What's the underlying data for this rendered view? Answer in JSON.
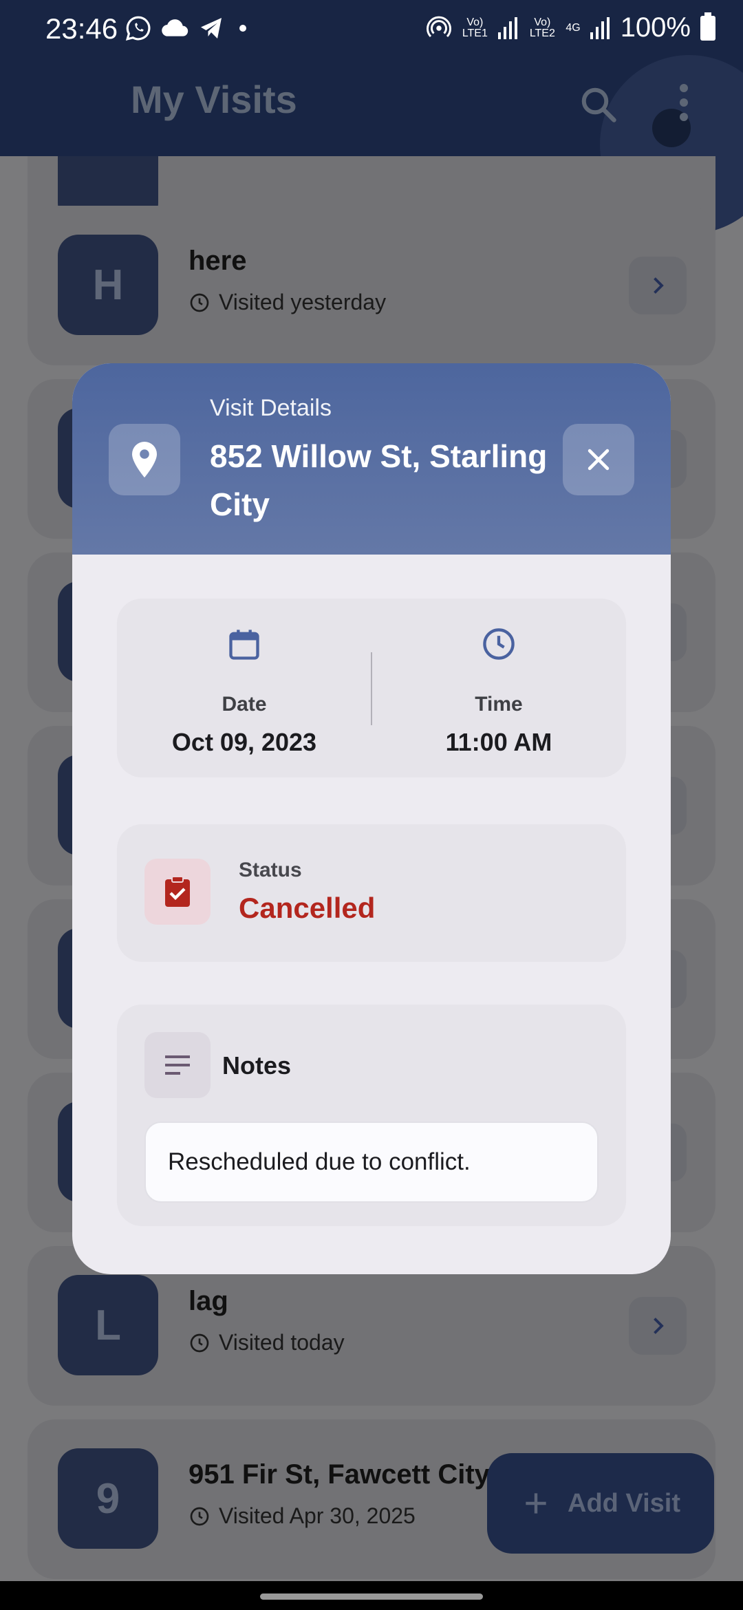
{
  "status_bar": {
    "time": "23:46",
    "network_1": "Vo) LTE1",
    "network_2": "Vo) LTE2",
    "network_type": "4G",
    "battery": "100%"
  },
  "app_bar": {
    "title": "My Visits",
    "search_icon": "search-icon",
    "menu_icon": "more-vert-icon"
  },
  "visits": [
    {
      "initial": "H",
      "name": "here",
      "visited": "Visited yesterday"
    },
    {
      "initial": "L",
      "name": "lag",
      "visited": "Visited today"
    },
    {
      "initial": "9",
      "name": "951 Fir St, Fawcett City",
      "visited": "Visited Apr 30, 2025"
    }
  ],
  "fab": {
    "label": "Add Visit",
    "icon": "plus-icon"
  },
  "dialog": {
    "kicker": "Visit Details",
    "title": "852 Willow St, Starling City",
    "date_label": "Date",
    "date_value": "Oct 09, 2023",
    "time_label": "Time",
    "time_value": "11:00 AM",
    "status_label": "Status",
    "status_value": "Cancelled",
    "notes_label": "Notes",
    "notes_value": "Rescheduled due to conflict.",
    "colors": {
      "header": "#4d669e",
      "status": "#b3261e"
    }
  }
}
